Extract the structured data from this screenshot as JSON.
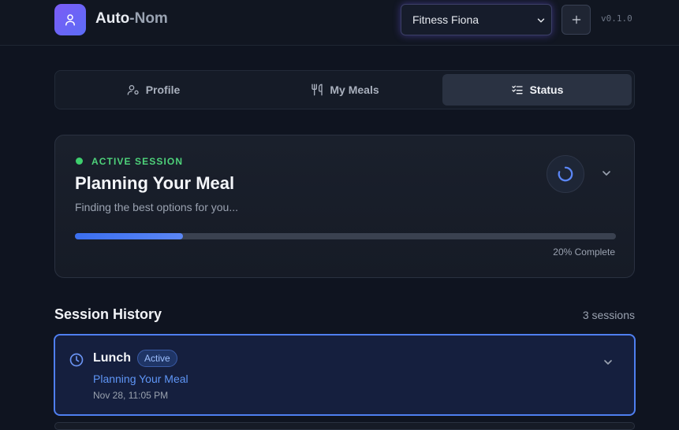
{
  "header": {
    "app_name_primary": "Auto",
    "app_name_secondary": "-Nom",
    "profile_selected": "Fitness Fiona",
    "add_label": "+",
    "version": "v0.1.0"
  },
  "tabs": [
    {
      "label": "Profile",
      "icon": "user-settings-icon",
      "active": false
    },
    {
      "label": "My Meals",
      "icon": "utensils-icon",
      "active": false
    },
    {
      "label": "Status",
      "icon": "list-checks-icon",
      "active": true
    }
  ],
  "active_session": {
    "label": "ACTIVE SESSION",
    "title": "Planning Your Meal",
    "subtitle": "Finding the best options for you...",
    "progress_percent": 20,
    "progress_text": "20% Complete"
  },
  "history": {
    "title": "Session History",
    "count_text": "3 sessions",
    "items": [
      {
        "name": "Lunch",
        "badge": "Active",
        "status": "Planning Your Meal",
        "time": "Nov 28, 11:05 PM"
      }
    ]
  },
  "colors": {
    "accent": "#4f7ff0",
    "active_green": "#4ed27a",
    "logo_gradient_start": "#7c5cf6",
    "logo_gradient_end": "#5b6cf6"
  }
}
